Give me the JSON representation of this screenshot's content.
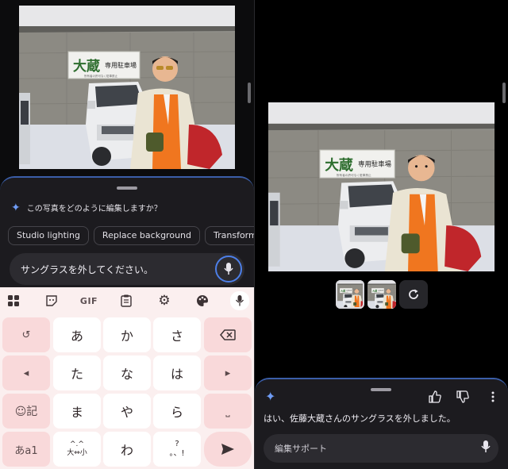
{
  "left_editor": {
    "prompt": "この写真をどのように編集しますか？",
    "chips": [
      "Studio lighting",
      "Replace background",
      "Transform ob"
    ],
    "input_value": "サングラスを外してください。",
    "icons": {
      "spark": "sparkle-icon",
      "mic": "mic-icon"
    }
  },
  "photo": {
    "sign_title": "大蔵",
    "sign_subtitle": "専用駐車場",
    "sign_small": "所有者の許可なく駐車禁止"
  },
  "keyboard": {
    "toolbar": {
      "gif_label": "GIF",
      "icons": [
        "apps-grid-icon",
        "sticker-icon",
        "gif-icon",
        "clipboard-icon",
        "settings-gear-icon",
        "palette-icon",
        "mic-icon"
      ]
    },
    "keys": {
      "undo": "↺",
      "a": "あ",
      "ka": "か",
      "sa": "さ",
      "left": "◂",
      "ta": "た",
      "na": "な",
      "ha": "は",
      "right": "▸",
      "emoji": "☺記",
      "ma": "ま",
      "ya": "や",
      "ra": "ら",
      "space": "⎵",
      "mode": "あa1",
      "kaomoji_top": "^.^",
      "kaomoji_bottom": "大⇔小",
      "wa": "わ",
      "punct_top": "?",
      "punct_bottom": "。、!"
    }
  },
  "right_result": {
    "message": "はい、佐藤大蔵さんのサングラスを外しました。",
    "assist_placeholder": "編集サポート",
    "icons": [
      "sparkle-icon",
      "thumbs-up-icon",
      "thumbs-down-icon",
      "more-vert-icon",
      "refresh-icon",
      "mic-icon"
    ]
  },
  "colors": {
    "accent": "#4d7fe8",
    "sheet_bg": "#1c1b1f",
    "keyboard_bg": "#fbefef",
    "key_func": "#f9d9da"
  }
}
